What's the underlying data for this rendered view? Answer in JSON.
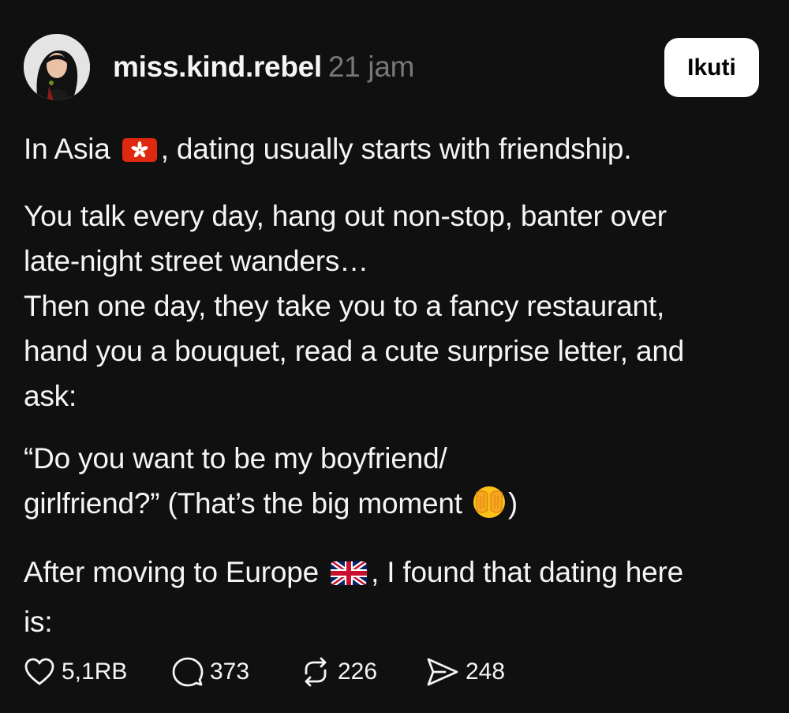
{
  "post": {
    "username": "miss.kind.rebel",
    "timestamp": "21 jam",
    "follow_label": "Ikuti",
    "avatar_icon": "profile-photo",
    "paragraphs": [
      {
        "lines": [
          {
            "before": "In Asia ",
            "inline": "hong-kong-flag-icon",
            "after": ", dating usually starts with friendship."
          }
        ]
      },
      {
        "lines": [
          {
            "text": "You talk every day, hang out non-stop, banter over"
          },
          {
            "text": "late-night street wanders…"
          },
          {
            "text": "Then one day, they take you to a fancy restaurant,"
          },
          {
            "text": "hand you a bouquet, read a cute surprise letter, and"
          },
          {
            "text": "ask:"
          }
        ]
      },
      {
        "lines": [
          {
            "text": "“Do you want to be my boyfriend/"
          },
          {
            "before": "girlfriend?” (That’s the big moment ",
            "inline": "face-with-peeking-eye-icon",
            "after": ")"
          }
        ]
      },
      {
        "lines": [
          {
            "before": "After moving to Europe ",
            "inline": "uk-flag-icon",
            "after": ", I found that dating here"
          },
          {
            "text": "is:"
          }
        ]
      }
    ],
    "actions": {
      "likes": "5,1RB",
      "replies": "373",
      "reposts": "226",
      "shares": "248"
    },
    "icons": [
      "heart-icon",
      "comment-icon",
      "repost-icon",
      "share-icon"
    ]
  },
  "colors": {
    "background": "#101010",
    "text": "#f3f5f7",
    "muted": "#777777",
    "button_bg": "#ffffff",
    "button_text": "#000000"
  }
}
